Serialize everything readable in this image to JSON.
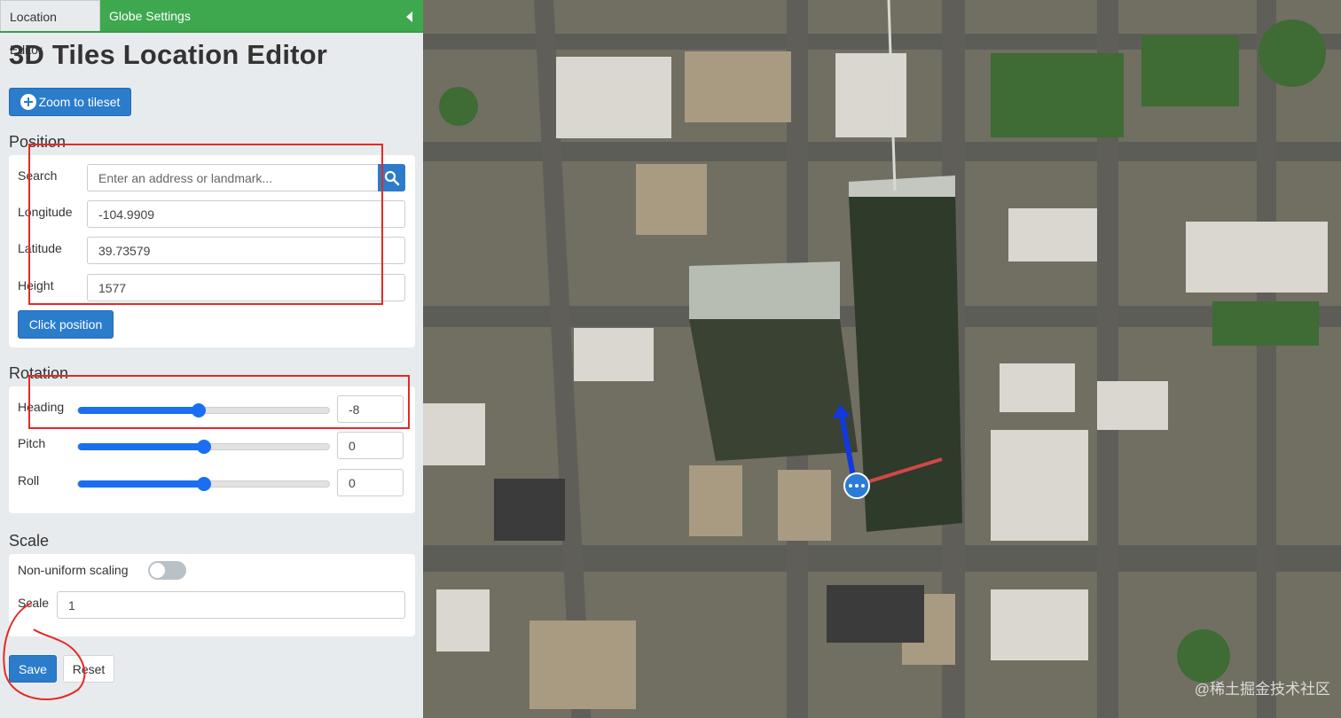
{
  "tabs": {
    "active": "Location Editor",
    "secondary": "Globe Settings"
  },
  "title": "3D Tiles Location Editor",
  "zoom_button": "Zoom to tileset",
  "position": {
    "heading": "Position",
    "search_label": "Search",
    "search_placeholder": "Enter an address or landmark...",
    "longitude_label": "Longitude",
    "longitude": "-104.9909",
    "latitude_label": "Latitude",
    "latitude": "39.73579",
    "height_label": "Height",
    "height": "1577",
    "click_button": "Click position"
  },
  "rotation": {
    "heading": "Rotation",
    "heading_label": "Heading",
    "heading_value": "-8",
    "heading_fraction": 0.48,
    "pitch_label": "Pitch",
    "pitch_value": "0",
    "pitch_fraction": 0.5,
    "roll_label": "Roll",
    "roll_value": "0",
    "roll_fraction": 0.5
  },
  "scale": {
    "heading": "Scale",
    "nonuniform_label": "Non-uniform scaling",
    "nonuniform_enabled": false,
    "scale_label": "Scale",
    "scale_value": "1"
  },
  "actions": {
    "save": "Save",
    "reset": "Reset"
  },
  "watermark": "@稀土掘金技术社区",
  "colors": {
    "accent": "#2b7ccb",
    "tab_green": "#3ea84f",
    "slider": "#1a6ff0",
    "annotation_red": "#e42a24"
  }
}
